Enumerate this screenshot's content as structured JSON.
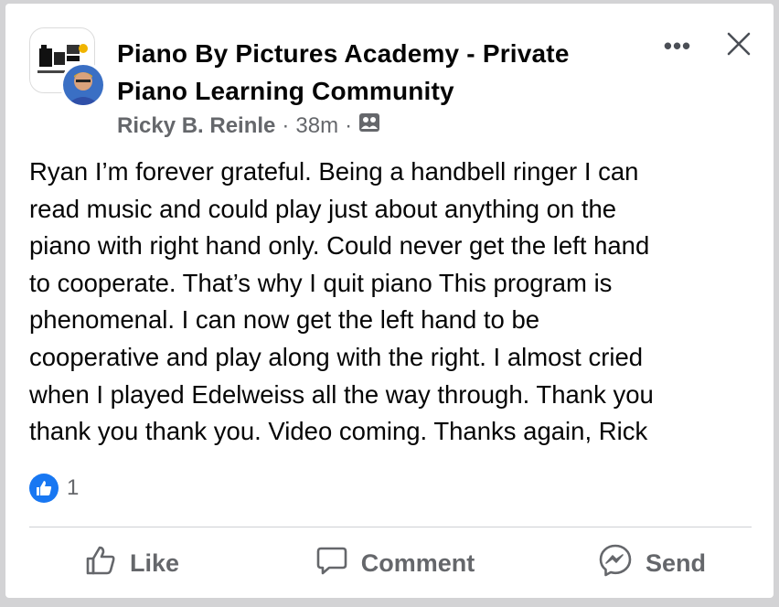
{
  "post": {
    "group_name": "Piano By Pictures Academy - Private Piano Learning Community",
    "author": "Ricky B. Reinle",
    "separator": "·",
    "time": "38m",
    "privacy_icon": "group-members-icon",
    "text": "Ryan  I’m forever grateful. Being a handbell ringer I can\nread music and could play just about anything on the\npiano with right hand only. Could never get the left hand\nto cooperate. That’s why I quit piano This program is\nphenomenal. I can now get the left hand to be\ncooperative and play along with the right. I almost cried\nwhen I played Edelweiss all the way through.  Thank you\nthank you thank you. Video coming. Thanks again, Rick"
  },
  "header": {
    "more_label": "•••",
    "close_icon": "close-icon"
  },
  "reactions": {
    "icon": "thumbs-up-icon",
    "count": "1"
  },
  "actions": {
    "like_label": "Like",
    "comment_label": "Comment",
    "send_label": "Send"
  },
  "colors": {
    "brand_blue": "#1877f2",
    "secondary_text": "#65676b",
    "primary_text": "#050505",
    "divider": "#ced0d4"
  }
}
